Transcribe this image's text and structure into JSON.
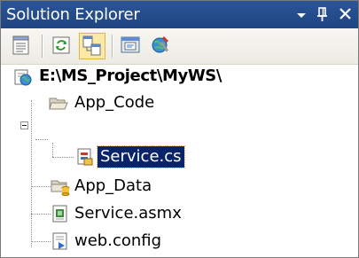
{
  "window": {
    "title": "Solution Explorer",
    "controls": {
      "dropdown_icon": "dropdown-arrow-icon",
      "pin_icon": "pin-icon",
      "close_icon": "close-icon"
    }
  },
  "toolbar": {
    "buttons": [
      {
        "name": "properties-button",
        "icon": "properties-icon",
        "pressed": false
      },
      {
        "name": "refresh-button",
        "icon": "refresh-icon",
        "pressed": false
      },
      {
        "name": "nest-related-files-button",
        "icon": "nest-related-files-icon",
        "pressed": true
      },
      {
        "name": "view-designer-button",
        "icon": "view-designer-icon",
        "pressed": false
      },
      {
        "name": "asp-net-configuration-button",
        "icon": "asp-net-configuration-icon",
        "pressed": false
      }
    ]
  },
  "tree": {
    "root": {
      "label": "E:\\MS_Project\\MyWS\\",
      "icon": "website-icon"
    },
    "items": [
      {
        "label": "App_Code",
        "icon": "open-folder-icon",
        "level": 1,
        "expanded": true
      },
      {
        "label": "Service.cs",
        "icon": "csharp-file-icon",
        "level": 2,
        "selected": true
      },
      {
        "label": "App_Data",
        "icon": "data-folder-icon",
        "level": 1
      },
      {
        "label": "Service.asmx",
        "icon": "asmx-file-icon",
        "level": 1
      },
      {
        "label": "web.config",
        "icon": "config-file-icon",
        "level": 1
      }
    ]
  },
  "colors": {
    "titlebar": "#2b5596",
    "selection": "#0a246a",
    "toolbar_pressed": "#fbe9a6"
  }
}
